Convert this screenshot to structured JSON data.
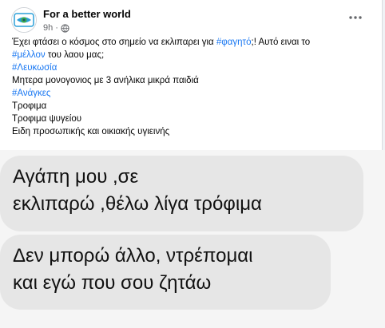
{
  "post": {
    "author": "For a better world",
    "time": "9h",
    "separator": "·",
    "more_icon": "ellipsis-icon",
    "privacy_icon": "globe-icon",
    "lines": [
      {
        "parts": [
          {
            "text": "Έχει φτάσει ο κόσμος στο σημείο να εκλιπαρει για ",
            "tag": false
          },
          {
            "text": "#φαγητό",
            "tag": true
          },
          {
            "text": ";! Αυτό ειναι το",
            "tag": false
          }
        ]
      },
      {
        "parts": [
          {
            "text": "#μέλλον",
            "tag": true
          },
          {
            "text": " του λαου μας;",
            "tag": false
          }
        ]
      },
      {
        "parts": [
          {
            "text": "#Λευκωσία",
            "tag": true
          }
        ]
      },
      {
        "parts": [
          {
            "text": "Μητερα μονογονιος με 3 ανήλικα μικρά παιδιά",
            "tag": false
          }
        ]
      },
      {
        "parts": [
          {
            "text": "#Ανάγκες",
            "tag": true
          }
        ]
      },
      {
        "parts": [
          {
            "text": "Τροφιμα",
            "tag": false
          }
        ]
      },
      {
        "parts": [
          {
            "text": "Τροφιμα ψυγείου",
            "tag": false
          }
        ]
      },
      {
        "parts": [
          {
            "text": "Ειδη προσωπικής και οικιακής υγιεινής",
            "tag": false
          }
        ]
      }
    ]
  },
  "messages": [
    {
      "lines": [
        "Αγάπη μου ,σε",
        "εκλιπαρώ ,θέλω λίγα τρόφιμα"
      ]
    },
    {
      "lines": [
        "Δεν μπορώ άλλο, ντρέπομαι",
        "και εγώ που σου ζητάω"
      ]
    }
  ],
  "colors": {
    "hashtag": "#1877f2",
    "bubble": "#e6e6e6",
    "logo_blue": "#2a9fd8",
    "logo_green": "#3fae49"
  }
}
